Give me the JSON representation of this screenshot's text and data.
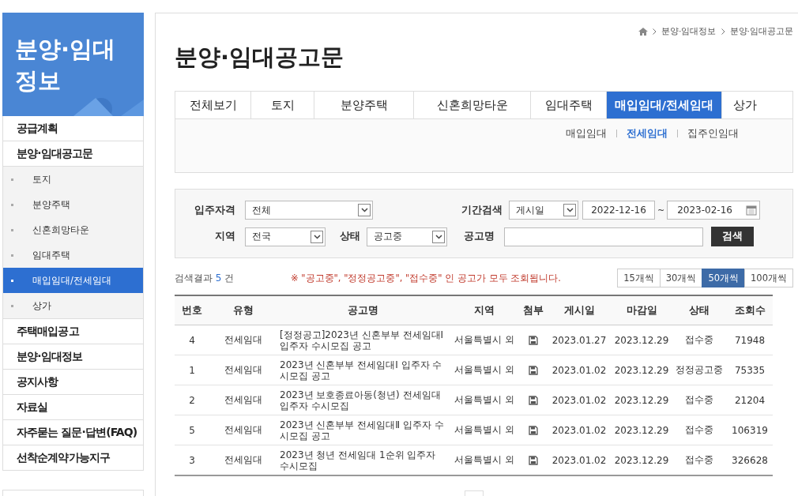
{
  "sidebar": {
    "title": "분양·임대\n정보",
    "items": [
      {
        "label": "공급계획",
        "selected": false
      },
      {
        "label": "분양·임대공고문",
        "selected": false,
        "children": [
          {
            "label": "토지",
            "selected": false
          },
          {
            "label": "분양주택",
            "selected": false
          },
          {
            "label": "신혼희망타운",
            "selected": false
          },
          {
            "label": "임대주택",
            "selected": false
          },
          {
            "label": "매입임대/전세임대",
            "selected": true
          },
          {
            "label": "상가",
            "selected": false
          }
        ]
      },
      {
        "label": "주택매입공고",
        "selected": false
      },
      {
        "label": "분양·임대정보",
        "selected": false
      },
      {
        "label": "공지사항",
        "selected": false
      },
      {
        "label": "자료실",
        "selected": false
      },
      {
        "label": "자주묻는 질문·답변(FAQ)",
        "selected": false
      },
      {
        "label": "선착순계약가능지구",
        "selected": false
      }
    ]
  },
  "breadcrumb": [
    "분양·임대정보",
    "분양·임대공고문"
  ],
  "page_title": "분양·임대공고문",
  "tabs": [
    {
      "label": "전체보기",
      "selected": false
    },
    {
      "label": "토지",
      "selected": false
    },
    {
      "label": "분양주택",
      "selected": false
    },
    {
      "label": "신혼희망타운",
      "selected": false
    },
    {
      "label": "임대주택",
      "selected": false
    },
    {
      "label": "매입임대/전세임대",
      "selected": true
    },
    {
      "label": "상가",
      "selected": false
    }
  ],
  "subtabs": [
    {
      "label": "매입임대",
      "selected": false
    },
    {
      "label": "전세임대",
      "selected": true
    },
    {
      "label": "집주인임대",
      "selected": false
    }
  ],
  "search_form": {
    "qualification": {
      "label": "입주자격",
      "value": "전체"
    },
    "period": {
      "label": "기간검색",
      "basis": "게시일",
      "start": "2022-12-16",
      "separator": "~",
      "end": "2023-02-16"
    },
    "region": {
      "label": "지역",
      "value": "전국"
    },
    "status": {
      "label": "상태",
      "value": "공고중"
    },
    "title_field": {
      "label": "공고명"
    },
    "search_button": "검색"
  },
  "results": {
    "label": "검색결과",
    "count": "5",
    "unit": "건"
  },
  "notice": "※ \"공고중\", \"정정공고중\", \"접수중\" 인 공고가 모두 조회됩니다.",
  "page_sizes": [
    {
      "label": "15개씩",
      "selected": false
    },
    {
      "label": "30개씩",
      "selected": false
    },
    {
      "label": "50개씩",
      "selected": true
    },
    {
      "label": "100개씩",
      "selected": false
    }
  ],
  "table": {
    "columns": [
      "번호",
      "유형",
      "공고명",
      "지역",
      "첨부",
      "게시일",
      "마감일",
      "상태",
      "조회수"
    ],
    "rows": [
      {
        "no": "4",
        "type": "전세임대",
        "title": "[정정공고]2023년 신혼부부 전세임대Ⅰ 입주자 수시모집 공고",
        "region": "서울특별시 외",
        "attachment": true,
        "posted": "2023.01.27",
        "deadline": "2023.12.29",
        "status": "접수중",
        "views": "71948"
      },
      {
        "no": "1",
        "type": "전세임대",
        "title": "2023년 신혼부부 전세임대Ⅰ 입주자 수시모집 공고",
        "region": "서울특별시 외",
        "attachment": true,
        "posted": "2023.01.02",
        "deadline": "2023.12.29",
        "status": "정정공고중",
        "views": "75335"
      },
      {
        "no": "2",
        "type": "전세임대",
        "title": "2023년 보호종료아동(청년) 전세임대 입주자 수시모집",
        "region": "서울특별시 외",
        "attachment": true,
        "posted": "2023.01.02",
        "deadline": "2023.12.29",
        "status": "접수중",
        "views": "21204"
      },
      {
        "no": "5",
        "type": "전세임대",
        "title": "2023년 신혼부부 전세임대Ⅱ 입주자 수시모집 공고",
        "region": "서울특별시 외",
        "attachment": true,
        "posted": "2023.01.02",
        "deadline": "2023.12.29",
        "status": "접수중",
        "views": "106319"
      },
      {
        "no": "3",
        "type": "전세임대",
        "title": "2023년 청년 전세임대 1순위 입주자 수시모집",
        "region": "서울특별시 외",
        "attachment": true,
        "posted": "2023.01.02",
        "deadline": "2023.12.29",
        "status": "접수중",
        "views": "326628"
      }
    ]
  }
}
